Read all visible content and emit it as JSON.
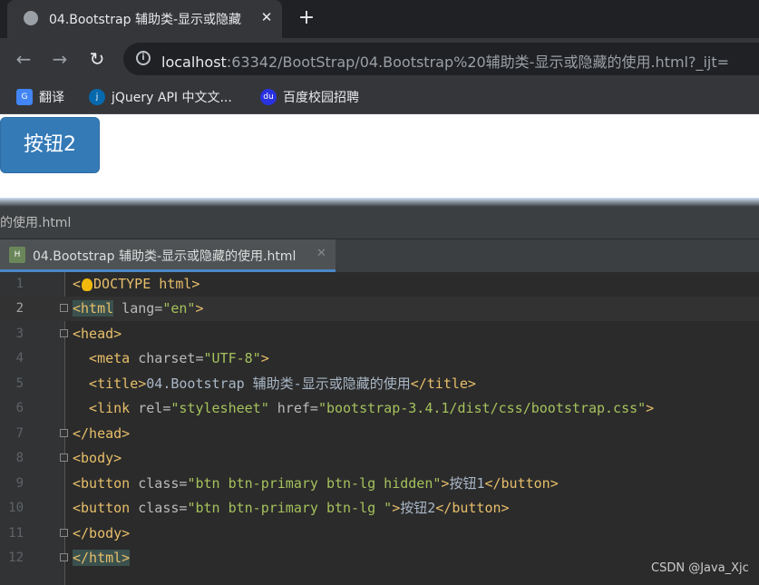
{
  "browser": {
    "tab_title": "04.Bootstrap 辅助类-显示或隐藏",
    "url_host": "localhost",
    "url_path": ":63342/BootStrap/04.Bootstrap%20辅助类-显示或隐藏的使用.html?_ijt=",
    "bookmarks": [
      {
        "label": "翻译",
        "icon": "google-translate-icon"
      },
      {
        "label": "jQuery API 中文文...",
        "icon": "jquery-icon"
      },
      {
        "label": "百度校园招聘",
        "icon": "baidu-icon"
      }
    ]
  },
  "page": {
    "button_label": "按钮2"
  },
  "ide": {
    "breadcrumb": "的使用.html",
    "tab_label": "04.Bootstrap 辅助类-显示或隐藏的使用.html",
    "lines": [
      "1",
      "2",
      "3",
      "4",
      "5",
      "6",
      "7",
      "8",
      "9",
      "10",
      "11",
      "12"
    ],
    "code": {
      "l1a": "<",
      "l1b": "DOCTYPE html>",
      "l2_tag": "<html",
      "l2_attr": " lang=",
      "l2_val": "\"en\"",
      "l2_end": ">",
      "l3": "<head>",
      "l4_tag": "  <meta",
      "l4_attr": " charset=",
      "l4_val": "\"UTF-8\"",
      "l4_end": ">",
      "l5_open": "  <title>",
      "l5_text": "04.Bootstrap 辅助类-显示或隐藏的使用",
      "l5_close": "</title>",
      "l6_tag": "  <link",
      "l6_attr1": " rel=",
      "l6_val1": "\"stylesheet\"",
      "l6_attr2": " href=",
      "l6_val2": "\"bootstrap-3.4.1/dist/css/bootstrap.css\"",
      "l6_end": ">",
      "l7": "</head>",
      "l8": "<body>",
      "l9_tag": "<button",
      "l9_attr": " class=",
      "l9_val": "\"btn btn-primary btn-lg hidden\"",
      "l9_gt": ">",
      "l9_text": "按钮1",
      "l9_close": "</button>",
      "l10_tag": "<button",
      "l10_attr": " class=",
      "l10_val": "\"btn btn-primary btn-lg \"",
      "l10_gt": ">",
      "l10_text": "按钮2",
      "l10_close": "</button>",
      "l11": "</body>",
      "l12": "</html>"
    }
  },
  "watermark": "CSDN @Java_Xjc"
}
